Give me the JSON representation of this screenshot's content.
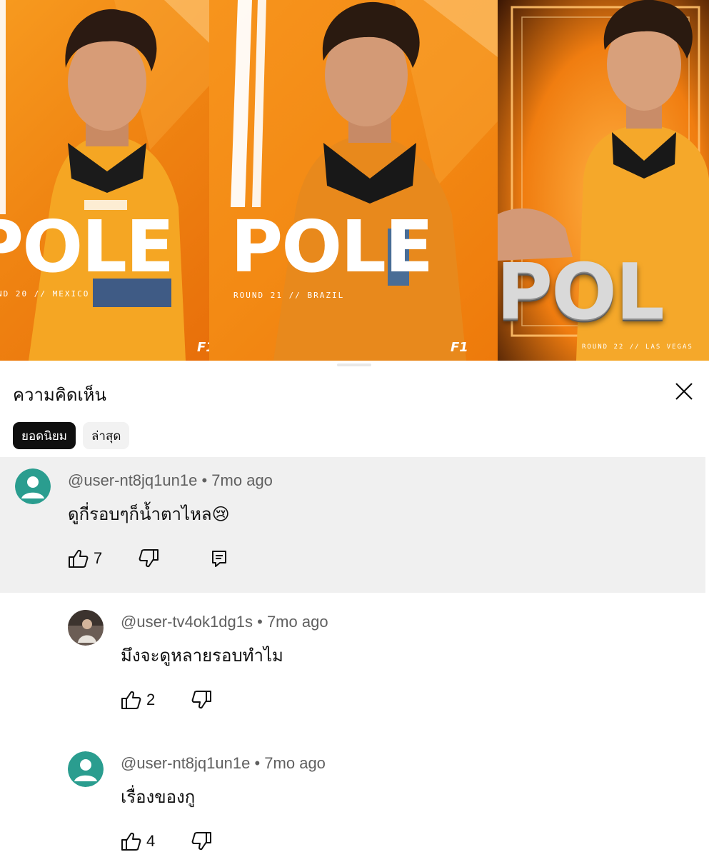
{
  "banner": {
    "panels": [
      {
        "word": "POLE",
        "round": "ND 20 // MEXICO",
        "logo": "F1"
      },
      {
        "word": "POLE",
        "round": "ROUND 21 // BRAZIL",
        "logo": "F1"
      },
      {
        "word": "POL",
        "round": "ROUND 22 // LAS VEGAS"
      }
    ]
  },
  "sheet": {
    "title": "ความคิดเห็น",
    "close_icon": "close-icon",
    "sort_chips": [
      {
        "label": "ยอดนิยม",
        "selected": true
      },
      {
        "label": "ล่าสุด",
        "selected": false
      }
    ]
  },
  "comments": [
    {
      "handle": "@user-nt8jq1un1e",
      "time": "7mo ago",
      "text": "ดูกี่รอบๆก็น้ำตาไหล😢",
      "likes": "7",
      "avatar": "default-avatar",
      "highlighted": true
    },
    {
      "handle": "@user-tv4ok1dg1s",
      "time": "7mo ago",
      "text": "มึงจะดูหลายรอบทำไม",
      "likes": "2",
      "avatar": "photo-avatar",
      "highlighted": false
    },
    {
      "handle": "@user-nt8jq1un1e",
      "time": "7mo ago",
      "text": "เรื่องของกู",
      "likes": "4",
      "avatar": "default-avatar",
      "highlighted": false
    }
  ],
  "colors": {
    "accent_orange": "#f08512",
    "highlight_bg": "#f0f0f0",
    "default_avatar": "#2a9d8f",
    "chip_active": "#0f0f0f"
  }
}
